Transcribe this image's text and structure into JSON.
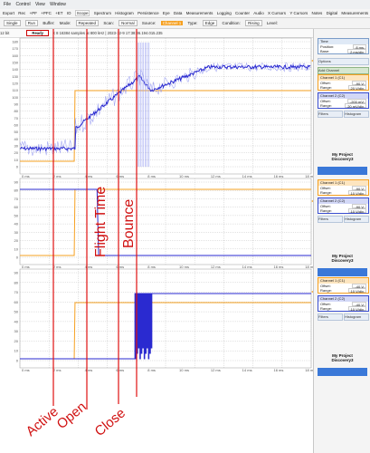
{
  "menu": {
    "items": [
      "File",
      "Control",
      "View",
      "Window"
    ]
  },
  "tabs": {
    "items": [
      "Export",
      "Rec",
      "+PF",
      "+PFC",
      "+ET",
      "IO",
      "Scope",
      "Spectrum",
      "Histogram",
      "Persistence",
      "Eye",
      "Data",
      "Measurements",
      "Logging",
      "Counter",
      "Audio",
      "X Cursors",
      "Y Cursors",
      "Notes",
      "Digital",
      "Measurements"
    ],
    "active_index": 6
  },
  "toolbar": {
    "single": "Single",
    "run": "Run",
    "buffer_label": "Buffer:",
    "mode": "Mode:",
    "mode_value": "Repeated",
    "scan": "Scan:",
    "scan_value": "Normal",
    "source": "Source:",
    "channel": "Channel 1",
    "type": "Type:",
    "edge": "Edge",
    "condition": "Condition:",
    "rising": "Rising",
    "level": "Level:"
  },
  "status": {
    "time_left": "12 bit",
    "state": "Ready",
    "info": "X 8   16384 samples at 800 kHz  |  2023-12-9 17:38:36.194.015.235"
  },
  "plots": {
    "x_ticks": [
      "0 ms",
      "2 ms",
      "4 ms",
      "6 ms",
      "8 ms",
      "10 ms",
      "12 ms",
      "14 ms",
      "16 ms",
      "18 ms"
    ],
    "panel1": {
      "y_ticks": [
        "180",
        "170",
        "160",
        "150",
        "140",
        "130",
        "120",
        "110",
        "100",
        "90",
        "80",
        "70",
        "60",
        "50",
        "40",
        "30",
        "20",
        "10",
        "0"
      ]
    },
    "panel2": {
      "y_ticks": [
        "90",
        "80",
        "70",
        "60",
        "50",
        "40",
        "30",
        "20",
        "10",
        "0"
      ]
    },
    "panel3": {
      "y_ticks": [
        "90",
        "80",
        "70",
        "60",
        "50",
        "40",
        "30",
        "20",
        "10",
        "0"
      ]
    }
  },
  "annotations": {
    "flight_time": "Flight Time",
    "bounce": "Bounce",
    "active": "Active",
    "open": "Open",
    "close": "Close"
  },
  "sidebar": {
    "time": {
      "title": "Time",
      "position_label": "Position:",
      "position_value": "8 ms",
      "base_label": "Base:",
      "base_value": "2 ms/div"
    },
    "options": "Options",
    "add_channel": "Add Channel",
    "panel1": {
      "ch1": {
        "title": "Channel 1 (C1)",
        "offset_label": "Offset:",
        "offset_value": "-90 V",
        "range_label": "Range:",
        "range_value": "20 V/div"
      },
      "ch2": {
        "title": "Channel 2 (C2)",
        "offset_label": "Offset:",
        "offset_value": "-200 mV",
        "range_label": "Range:",
        "range_value": "20 mV/div"
      },
      "filters": "Filters",
      "histograms": "Histogram"
    },
    "panel2": {
      "ch1": {
        "title": "Channel 1 (C1)",
        "offset_label": "Offset:",
        "offset_value": "-90 V",
        "range_label": "Range:",
        "range_value": "10 V/div"
      },
      "ch2": {
        "title": "Channel 2 (C2)",
        "offset_label": "Offset:",
        "offset_value": "-90 V",
        "range_label": "Range:",
        "range_value": "10 V/div"
      },
      "filters": "Filters",
      "histograms": "Histogram"
    },
    "panel3": {
      "ch1": {
        "title": "Channel 1 (C1)",
        "offset_label": "Offset:",
        "offset_value": "-40 V",
        "range_label": "Range:",
        "range_value": "10 V/div"
      },
      "ch2": {
        "title": "Channel 2 (C2)",
        "offset_label": "Offset:",
        "offset_value": "-40 V",
        "range_label": "Range:",
        "range_value": "10 V/div"
      },
      "filters": "Filters",
      "histograms": "Histogram"
    },
    "project": {
      "line1": "My Project",
      "line2": "Discovery3"
    }
  },
  "colors": {
    "ch1": "#f6a020",
    "ch2": "#2a2ad0",
    "marker": "#e01010",
    "grid": "#b8b8b8"
  }
}
